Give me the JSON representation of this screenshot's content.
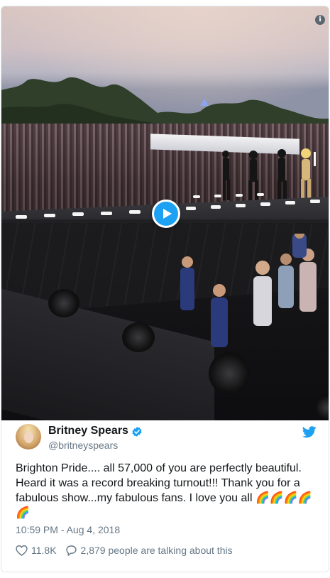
{
  "tweet": {
    "display_name": "Britney Spears",
    "handle": "@britneyspears",
    "text": "Brighton Pride.... all 57,000 of you are perfectly beautiful. Heard it was a record breaking turnout!!! Thank you for a fabulous show...my fabulous fans. I love you all 🌈🌈🌈🌈🌈",
    "timestamp": "10:59 PM - Aug 4, 2018",
    "likes": "11.8K",
    "conversation": "2,879 people are talking about this",
    "verified": true
  },
  "media": {
    "type": "video",
    "play_icon": "play-icon",
    "info_icon": "info-icon",
    "info_glyph": "i"
  },
  "icons": {
    "verified": "verified-badge-icon",
    "brand": "twitter-bird-icon",
    "like": "heart-icon",
    "reply": "speech-bubble-icon"
  },
  "colors": {
    "accent": "#1da1f2",
    "text": "#14171a",
    "muted": "#657786",
    "border": "#e1e8ed"
  }
}
